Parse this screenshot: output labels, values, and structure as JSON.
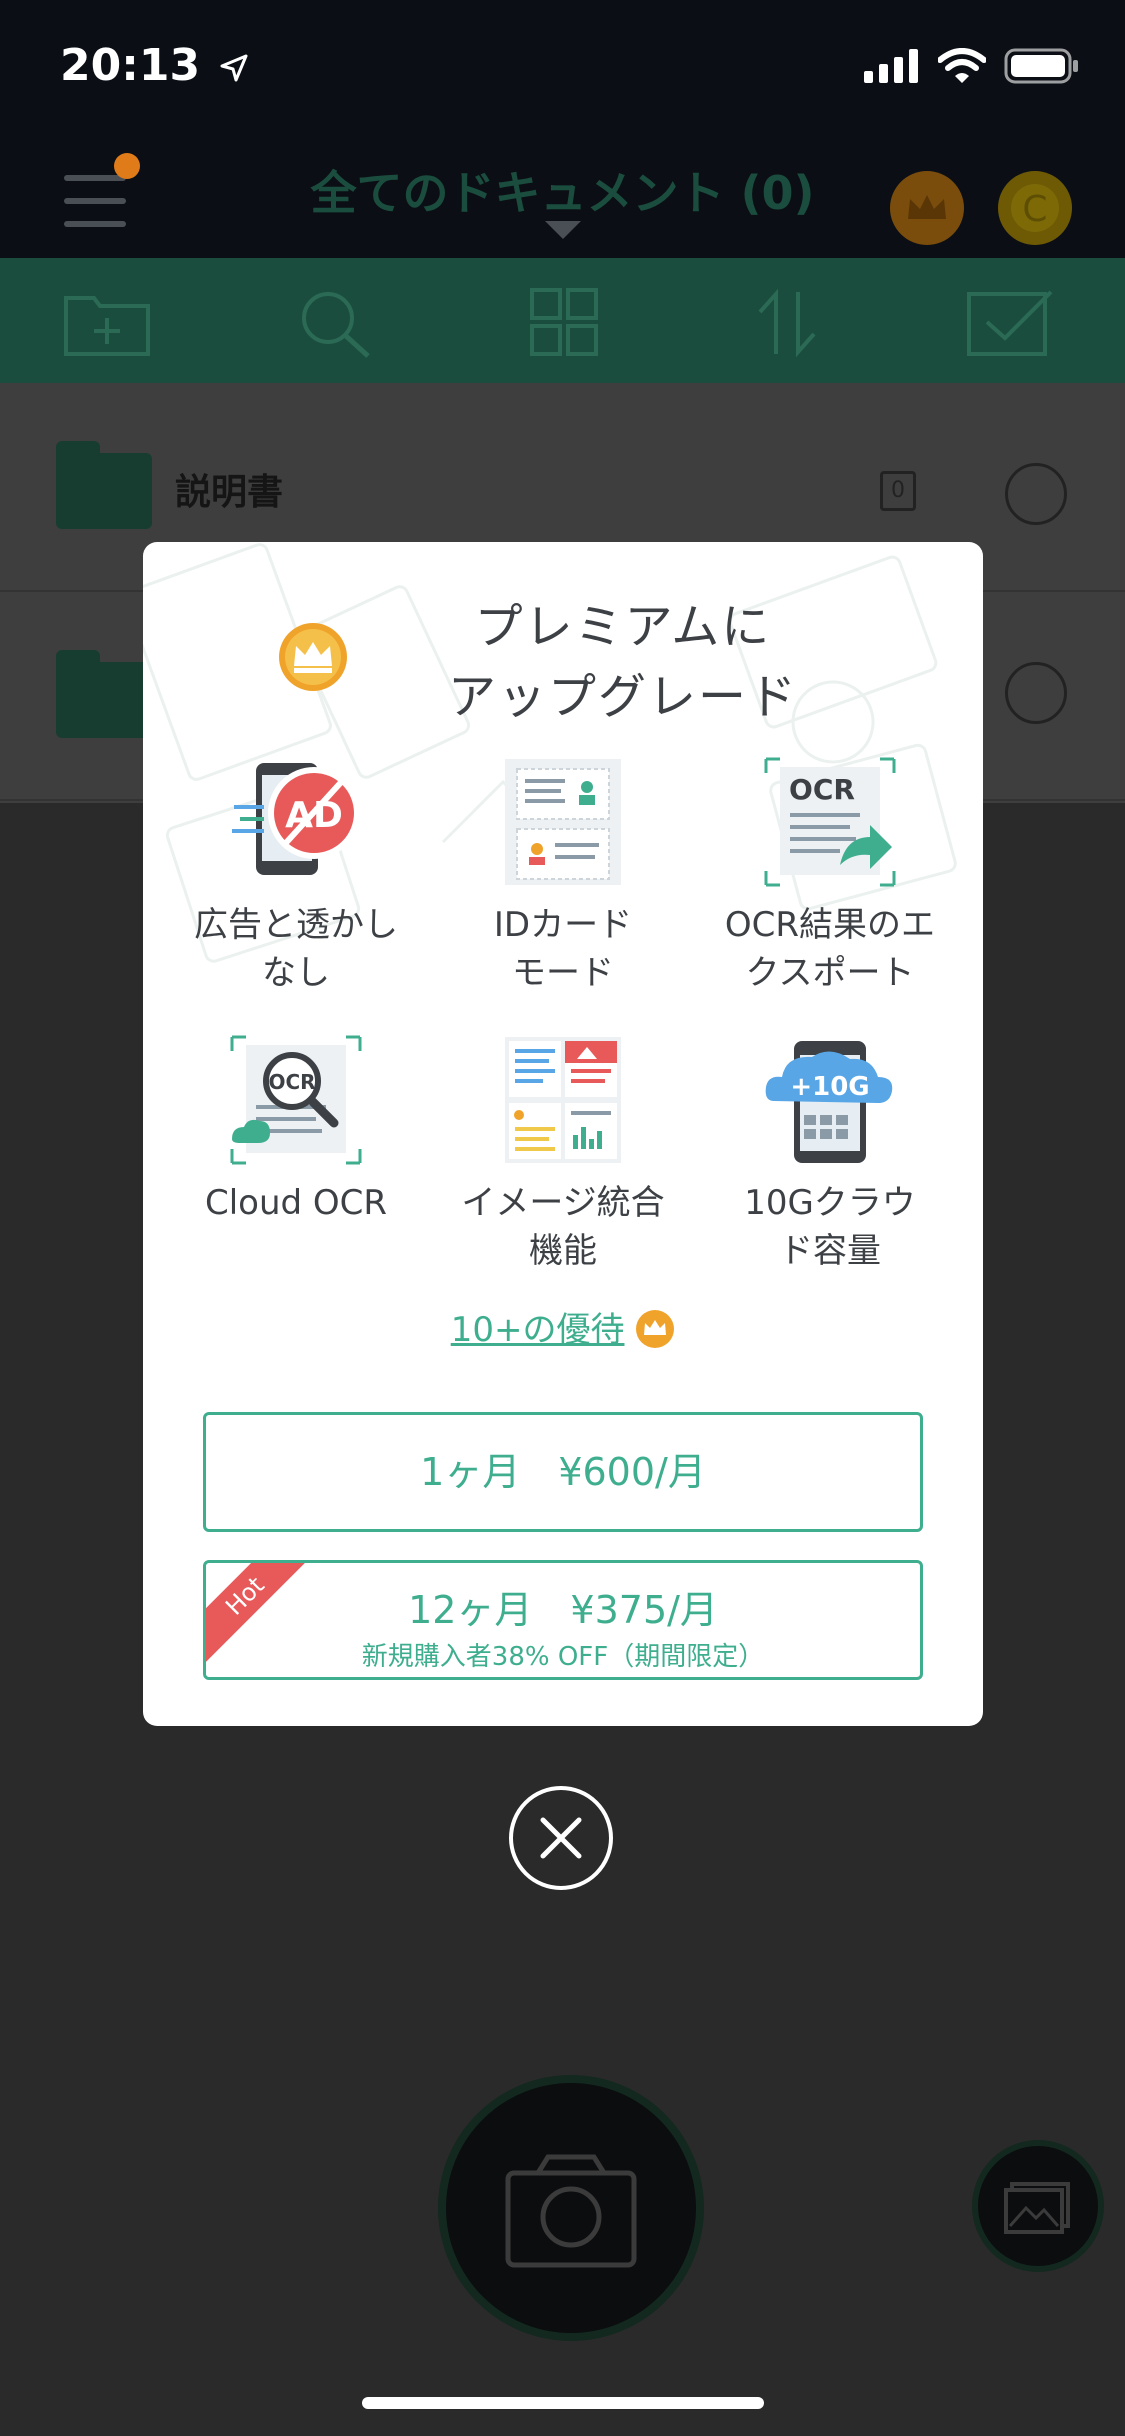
{
  "status_bar": {
    "time": "20:13"
  },
  "navbar": {
    "title": "全てのドキュメント (0)"
  },
  "documents": [
    {
      "name": "説明書",
      "count": "0"
    },
    {
      "name": ""
    }
  ],
  "modal": {
    "title_line1": "プレミアムに",
    "title_line2": "アップグレード",
    "features": [
      {
        "label": "広告と透かしなし",
        "icon": "no-ads-icon"
      },
      {
        "label": "IDカードモード",
        "icon": "id-card-icon"
      },
      {
        "label": "OCR結果のエクスポート",
        "icon": "ocr-export-icon"
      },
      {
        "label": "Cloud OCR",
        "icon": "cloud-ocr-icon"
      },
      {
        "label": "イメージ統合機能",
        "icon": "image-merge-icon"
      },
      {
        "label": "10Gクラウド容量",
        "icon": "cloud-storage-icon"
      }
    ],
    "ad_badge": "AD",
    "ocr_badge": "OCR",
    "storage_badge": "+10G",
    "perks_link": "10+の優待",
    "plans": [
      {
        "label": "1ヶ月　¥600/月"
      },
      {
        "label": "12ヶ月　¥375/月",
        "sub": "新規購入者38% OFF（期間限定）",
        "ribbon": "Hot"
      }
    ]
  },
  "colors": {
    "accent": "#3fae8f",
    "crown": "#f0a32b",
    "ribbon": "#e85a5a"
  }
}
